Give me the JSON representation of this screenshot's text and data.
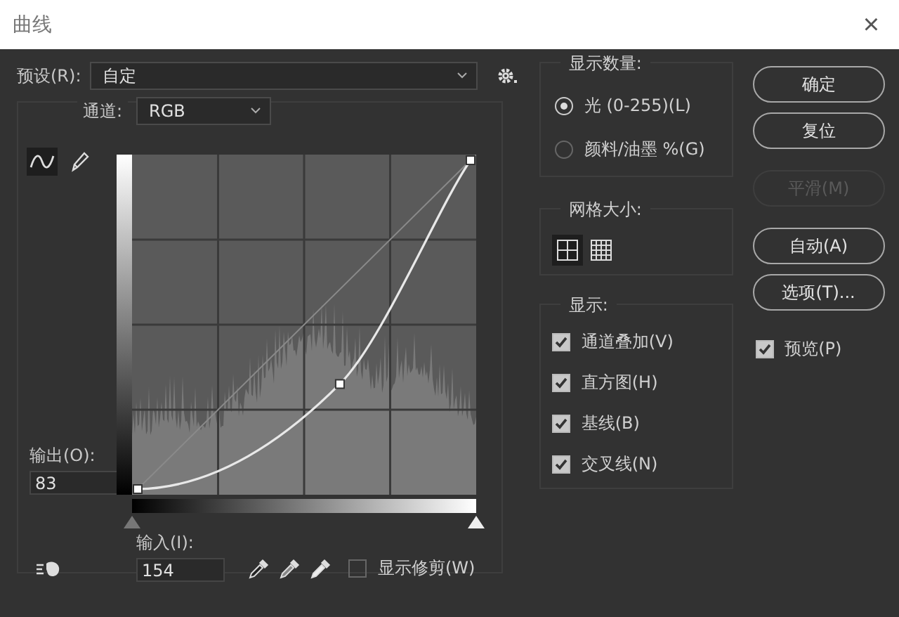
{
  "window": {
    "title": "曲线",
    "close": "×"
  },
  "preset": {
    "label": "预设(R):",
    "value": "自定"
  },
  "channel": {
    "label": "通道:",
    "value": "RGB"
  },
  "tools": [
    {
      "kind": "curve",
      "selected": true
    },
    {
      "kind": "pencil",
      "selected": false
    }
  ],
  "output": {
    "label": "输出(O):",
    "value": "83"
  },
  "input": {
    "label": "输入(I):",
    "value": "154"
  },
  "input_range": {
    "shadow": {
      "level": 0
    },
    "highlight": {
      "level": 1
    }
  },
  "show_clipping": {
    "label": "显示修剪(W)",
    "checked": false
  },
  "display_amount": {
    "title": "显示数量:",
    "options": [
      {
        "label": "光 (0-255)(L)",
        "selected": true
      },
      {
        "label": "颜料/油墨 %(G)",
        "selected": false
      }
    ]
  },
  "grid_size": {
    "title": "网格大小:",
    "options": [
      {
        "kind": "coarse",
        "selected": true
      },
      {
        "kind": "fine",
        "selected": false
      }
    ]
  },
  "display": {
    "title": "显示:",
    "options": [
      {
        "label": "通道叠加(V)",
        "checked": true
      },
      {
        "label": "直方图(H)",
        "checked": true
      },
      {
        "label": "基线(B)",
        "checked": true
      },
      {
        "label": "交叉线(N)",
        "checked": true
      }
    ]
  },
  "buttons": [
    {
      "label": "确定",
      "disabled": false
    },
    {
      "label": "复位",
      "disabled": false
    },
    {
      "label": "平滑(M)",
      "disabled": true
    },
    {
      "label": "自动(A)",
      "disabled": false
    },
    {
      "label": "选项(T)...",
      "disabled": false
    }
  ],
  "preview": {
    "label": "预览(P)",
    "checked": true
  }
}
